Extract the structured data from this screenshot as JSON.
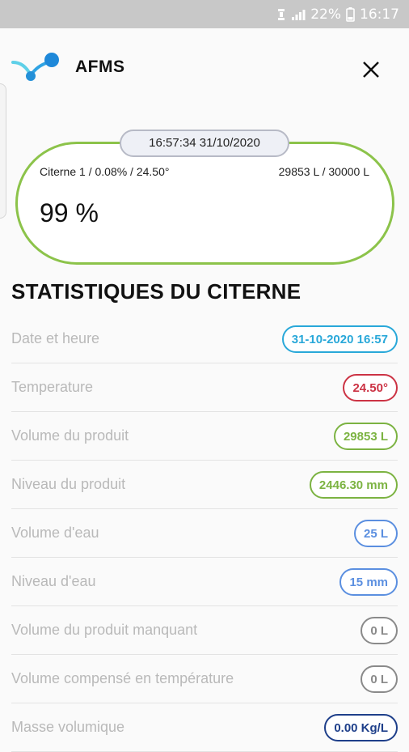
{
  "status_bar": {
    "battery": "22%",
    "time": "16:17"
  },
  "app": {
    "title": "AFMS"
  },
  "tank": {
    "timestamp": "16:57:34 31/10/2020",
    "info": "Citerne 1 / 0.08% / 24.50°",
    "volume": "29853 L / 30000 L",
    "percent": "99 %"
  },
  "stats": {
    "title": "STATISTIQUES DU CITERNE",
    "rows": [
      {
        "label": "Date et heure",
        "value": "31-10-2020 16:57",
        "color": "#29a8d9"
      },
      {
        "label": "Temperature",
        "value": "24.50°",
        "color": "#cc3344"
      },
      {
        "label": "Volume du produit",
        "value": "29853 L",
        "color": "#7cb342"
      },
      {
        "label": "Niveau du produit",
        "value": "2446.30 mm",
        "color": "#7cb342"
      },
      {
        "label": "Volume d'eau",
        "value": "25 L",
        "color": "#5b8fe0"
      },
      {
        "label": "Niveau d'eau",
        "value": "15 mm",
        "color": "#5b8fe0"
      },
      {
        "label": "Volume du produit manquant",
        "value": "0 L",
        "color": "#8a8a8a"
      },
      {
        "label": "Volume compensé en température",
        "value": "0 L",
        "color": "#8a8a8a"
      },
      {
        "label": "Masse volumique",
        "value": "0.00 Kg/L",
        "color": "#1e3f8a"
      }
    ]
  }
}
